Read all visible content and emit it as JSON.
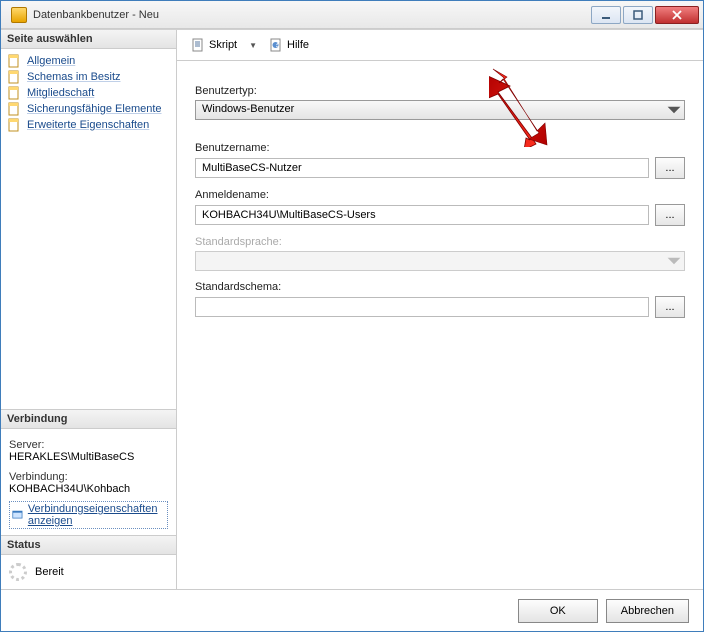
{
  "window": {
    "title": "Datenbankbenutzer - Neu"
  },
  "sidebar": {
    "select_page": "Seite auswählen",
    "items": [
      {
        "label": "Allgemein"
      },
      {
        "label": "Schemas im Besitz"
      },
      {
        "label": "Mitgliedschaft"
      },
      {
        "label": "Sicherungsfähige Elemente"
      },
      {
        "label": "Erweiterte Eigenschaften"
      }
    ],
    "connection": {
      "header": "Verbindung",
      "server_label": "Server:",
      "server_value": "HERAKLES\\MultiBaseCS",
      "connection_label": "Verbindung:",
      "connection_value": "KOHBACH34U\\Kohbach",
      "props_link": "Verbindungseigenschaften anzeigen"
    },
    "status": {
      "header": "Status",
      "text": "Bereit"
    }
  },
  "toolbar": {
    "script": "Skript",
    "help": "Hilfe"
  },
  "form": {
    "usertype_label": "Benutzertyp:",
    "usertype_value": "Windows-Benutzer",
    "username_label": "Benutzername:",
    "username_value": "MultiBaseCS-Nutzer",
    "loginname_label": "Anmeldename:",
    "loginname_value": "KOHBACH34U\\MultiBaseCS-Users",
    "language_label": "Standardsprache:",
    "language_value": "",
    "schema_label": "Standardschema:",
    "schema_value": "",
    "browse": "..."
  },
  "footer": {
    "ok": "OK",
    "cancel": "Abbrechen"
  }
}
